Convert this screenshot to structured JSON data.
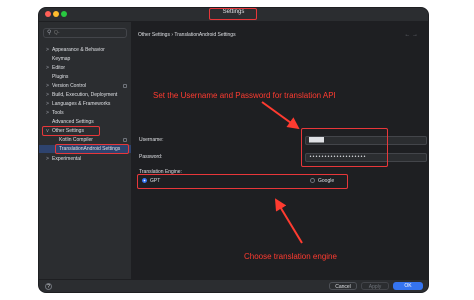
{
  "window": {
    "title": "Settings"
  },
  "search": {
    "placeholder": "Q-"
  },
  "sidebar": {
    "items": [
      {
        "label": "Appearance & Behavior",
        "chevron": ">"
      },
      {
        "label": "Keymap",
        "chevron": ""
      },
      {
        "label": "Editor",
        "chevron": ">"
      },
      {
        "label": "Plugins",
        "chevron": ""
      },
      {
        "label": "Version Control",
        "chevron": ">"
      },
      {
        "label": "Build, Execution, Deployment",
        "chevron": ">"
      },
      {
        "label": "Languages & Frameworks",
        "chevron": ">"
      },
      {
        "label": "Tools",
        "chevron": ">"
      },
      {
        "label": "Advanced Settings",
        "chevron": ""
      },
      {
        "label": "Other Settings",
        "chevron": "v"
      },
      {
        "label": "Kotlin Compiler",
        "chevron": ""
      },
      {
        "label": "TranslationAndroid Settings",
        "chevron": ""
      },
      {
        "label": "Experimental",
        "chevron": ">"
      }
    ]
  },
  "breadcrumb": {
    "parent": "Other Settings",
    "separator": "›",
    "current": "TranslationAndroid Settings"
  },
  "nav": {
    "back": "←",
    "forward": "→"
  },
  "annotations": {
    "top": "Set the Username and Password for translation API",
    "bottom": "Choose translation engine",
    "color": "#ff3b30"
  },
  "form": {
    "username_label": "Username:",
    "username_value": "█████",
    "password_label": "Password:",
    "password_value": "•••••••••••••••••••",
    "engine_label": "Translation Engine:",
    "engine_options": [
      "GPT",
      "Google"
    ],
    "engine_selected": "GPT"
  },
  "footer": {
    "help": "?",
    "cancel": "Cancel",
    "apply": "Apply",
    "ok": "OK"
  },
  "colors": {
    "accent": "#3574f0",
    "highlight": "#e8373a"
  }
}
